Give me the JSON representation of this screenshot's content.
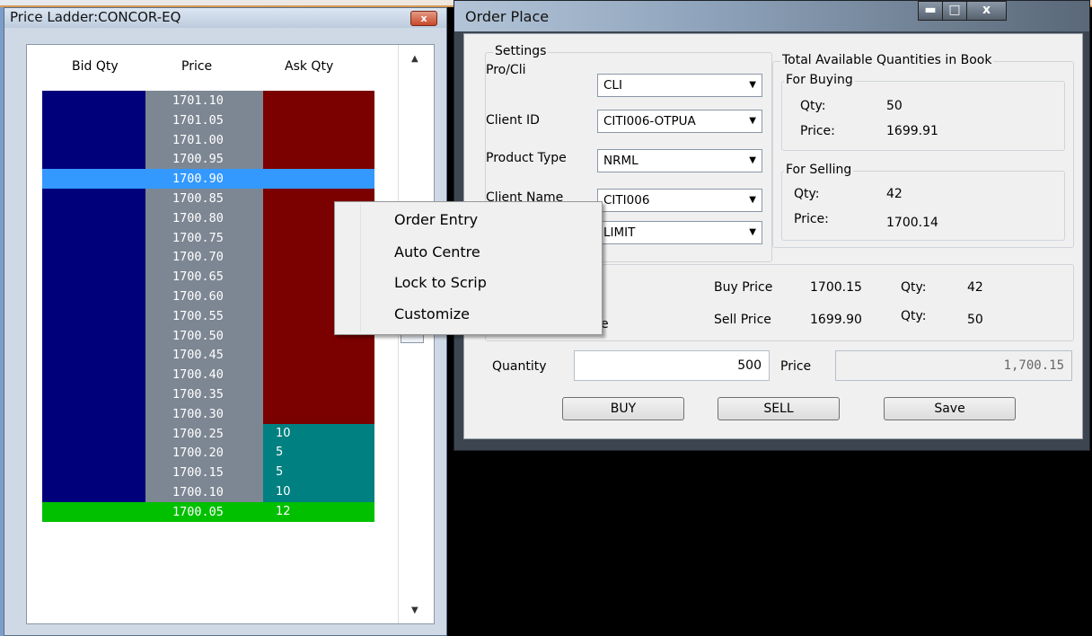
{
  "ladder": {
    "title": "Price Ladder:CONCOR-EQ",
    "close": "x",
    "headers": [
      "Bid Qty",
      "Price",
      "Ask Qty"
    ],
    "scroll_up": "▲",
    "scroll_down": "▼",
    "rows": [
      {
        "price": "1701.10",
        "ask": ""
      },
      {
        "price": "1701.05",
        "ask": ""
      },
      {
        "price": "1701.00",
        "ask": ""
      },
      {
        "price": "1700.95",
        "ask": ""
      },
      {
        "price": "1700.90",
        "ask": "",
        "selected": true
      },
      {
        "price": "1700.85",
        "ask": ""
      },
      {
        "price": "1700.80",
        "ask": ""
      },
      {
        "price": "1700.75",
        "ask": ""
      },
      {
        "price": "1700.70",
        "ask": ""
      },
      {
        "price": "1700.65",
        "ask": ""
      },
      {
        "price": "1700.60",
        "ask": ""
      },
      {
        "price": "1700.55",
        "ask": ""
      },
      {
        "price": "1700.50",
        "ask": ""
      },
      {
        "price": "1700.45",
        "ask": ""
      },
      {
        "price": "1700.40",
        "ask": ""
      },
      {
        "price": "1700.35",
        "ask": ""
      },
      {
        "price": "1700.30",
        "ask": ""
      },
      {
        "price": "1700.25",
        "ask": "10",
        "bid_side": true
      },
      {
        "price": "1700.20",
        "ask": "5",
        "bid_side": true
      },
      {
        "price": "1700.15",
        "ask": "5",
        "bid_side": true
      },
      {
        "price": "1700.10",
        "ask": "10",
        "bid_side": true
      },
      {
        "price": "1700.05",
        "ask": "12",
        "last": true
      }
    ],
    "colors": {
      "bid": "#00007b",
      "price": "#7d8793",
      "ask": "#7b0000",
      "teal": "#008080",
      "selected": "#3399ff",
      "last": "#00c000"
    }
  },
  "context_menu": {
    "items": [
      "Order Entry",
      "Auto Centre",
      "Lock to Scrip",
      "Customize"
    ]
  },
  "order": {
    "title": "Order Place",
    "window_buttons": {
      "min": "▬",
      "max": "□",
      "close": "x"
    },
    "settings": {
      "caption": "Settings",
      "pro_cli_label": "Pro/Cli",
      "pro_cli_value": "CLI",
      "client_id_label": "Client ID",
      "client_id_value": "CITI006-OTPUA",
      "product_type_label": "Product Type",
      "product_type_value": "NRML",
      "client_name_label": "Client Name",
      "client_name_value": "CITI006",
      "order_type_value": "LIMIT"
    },
    "book": {
      "caption": "Total Available Quantities in Book",
      "buying": {
        "caption": "For Buying",
        "qty_label": "Qty:",
        "qty": "50",
        "price_label": "Price:",
        "price": "1699.91"
      },
      "selling": {
        "caption": "For Selling",
        "qty_label": "Qty:",
        "qty": "42",
        "price_label": "Price:",
        "price": "1700.14"
      }
    },
    "best": {
      "buy_price_label": "Buy Price",
      "buy_price": "1700.15",
      "buy_qty_label": "Qty:",
      "buy_qty": "42",
      "sell_price_label": "Sell Price",
      "sell_price": "1699.90",
      "sell_qty_label": "Qty:",
      "sell_qty": "50",
      "obscured_tail": "e"
    },
    "quantity_label": "Quantity",
    "quantity_value": "500",
    "price_label": "Price",
    "price_value": "1,700.15",
    "buttons": {
      "buy": "BUY",
      "sell": "SELL",
      "save": "Save"
    }
  }
}
